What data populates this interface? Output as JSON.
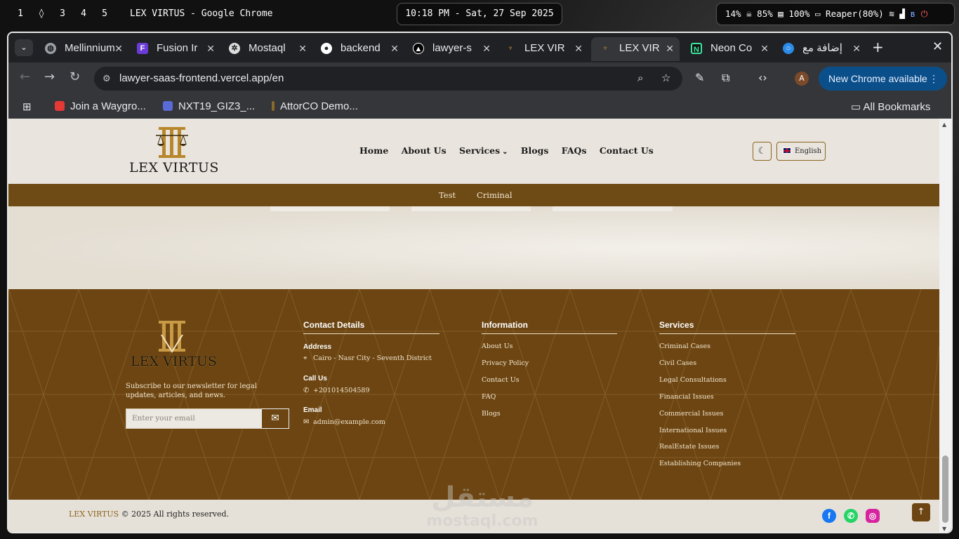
{
  "system_bar": {
    "workspaces": [
      "1",
      "3",
      "4",
      "5"
    ],
    "window_title": "LEX VIRTUS - Google Chrome",
    "clock": "10:18 PM - Sat, 27 Sep 2025",
    "cpu": "14%",
    "memory": "85%",
    "disk": "100%",
    "battery": "Reaper(80%)"
  },
  "browser": {
    "tabs": [
      {
        "label": "Mellinnium",
        "icon": "globe-icon"
      },
      {
        "label": "Fusion Ir",
        "icon": "fusion-icon"
      },
      {
        "label": "Mostaql",
        "icon": "openai-icon"
      },
      {
        "label": "backend",
        "icon": "github-icon"
      },
      {
        "label": "lawyer-s",
        "icon": "vercel-icon"
      },
      {
        "label": "LEX VIR",
        "icon": "lex-icon"
      },
      {
        "label": "LEX VIR",
        "icon": "lex-icon",
        "active": true
      },
      {
        "label": "Neon Co",
        "icon": "neon-icon"
      },
      {
        "label": "إضافة مع",
        "icon": "mostaql-icon"
      }
    ],
    "url": "lawyer-saas-frontend.vercel.app/en",
    "update_label": "New Chrome available",
    "profile_initial": "A",
    "bookmarks": [
      {
        "label": "Join a Waygro...",
        "color": "#e53935"
      },
      {
        "label": "NXT19_GIZ3_...",
        "color": "#5b6bd6"
      },
      {
        "label": "AttorCO Demo...",
        "color": "#8a6a2a"
      }
    ],
    "all_bookmarks": "All Bookmarks"
  },
  "site": {
    "brand": "LEX VIRTUS",
    "nav": {
      "home": "Home",
      "about": "About Us",
      "services": "Services",
      "blogs": "Blogs",
      "faqs": "FAQs",
      "contact": "Contact Us"
    },
    "language": "English",
    "subnav": [
      "Test",
      "Criminal"
    ],
    "footer": {
      "newsletter_text": "Subscribe to our newsletter for legal updates, articles, and news.",
      "email_placeholder": "Enter your email",
      "contact_heading": "Contact Details",
      "address_label": "Address",
      "address": "Cairo - Nasr City - Seventh District",
      "call_label": "Call Us",
      "phone": "+201014504589",
      "email_label": "Email",
      "email": "admin@example.com",
      "info_heading": "Information",
      "info_links": [
        "About Us",
        "Privacy Policy",
        "Contact Us",
        "FAQ",
        "Blogs"
      ],
      "services_heading": "Services",
      "services_links": [
        "Criminal Cases",
        "Civil Cases",
        "Legal Consultations",
        "Financial Issues",
        "Commercial Issues",
        "International Issues",
        "RealEstate Issues",
        "Establishing Companies"
      ]
    },
    "copyright_brand": "LEX VIRTUS",
    "copyright_rest": "© 2025 All rights reserved.",
    "colors": {
      "brand_brown": "#6c4512",
      "gold": "#b8862b",
      "cream": "#e9e5de"
    }
  },
  "watermark": {
    "arabic": "مستقل",
    "latin": "mostaql.com"
  }
}
